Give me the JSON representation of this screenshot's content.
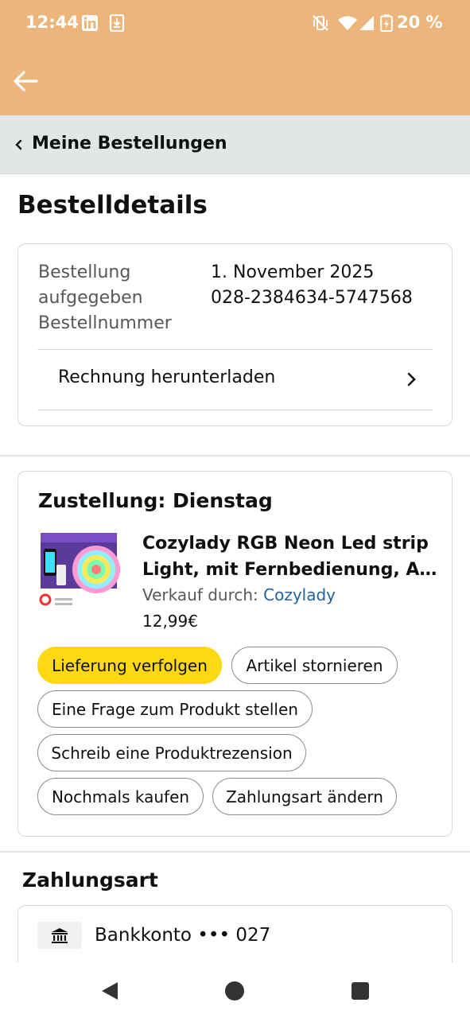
{
  "status_bar": {
    "time": "12:44",
    "battery_percent": "20 %",
    "icons": [
      "linkedin-icon",
      "download-icon",
      "mute-vibrate-icon",
      "wifi-icon",
      "signal-icon",
      "battery-charging-icon"
    ]
  },
  "colors": {
    "header_bg": "#ebb57c",
    "breadcrumb_bg": "#e3e6e6",
    "primary_button": "#ffd814",
    "link": "#2162a1",
    "muted_text": "#565959"
  },
  "breadcrumb": {
    "label": "Meine Bestellungen"
  },
  "page": {
    "title": "Bestelldetails"
  },
  "order_info": {
    "placed_label_1": "Bestellung",
    "placed_label_2": "aufgegeben",
    "placed_value": "1. November 2025",
    "number_label": "Bestellnummer",
    "number_value": "028-2384634-5747568",
    "invoice_label": "Rechnung herunterladen"
  },
  "delivery": {
    "title": "Zustellung: Dienstag",
    "product": {
      "title_line_1": "Cozylady RGB Neon Led strip",
      "title_line_2": "Light, mit Fernbedienung, A…",
      "sold_by_label": "Verkauf durch: ",
      "seller": "Cozylady",
      "price": "12,99€"
    },
    "buttons": {
      "track": "Lieferung verfolgen",
      "cancel": "Artikel stornieren",
      "question": "Eine Frage zum Produkt stellen",
      "review": "Schreib eine Produktrezension",
      "buy_again": "Nochmals kaufen",
      "change_payment": "Zahlungsart ändern"
    }
  },
  "payment": {
    "title": "Zahlungsart",
    "method": "Bankkonto ••• 027"
  }
}
